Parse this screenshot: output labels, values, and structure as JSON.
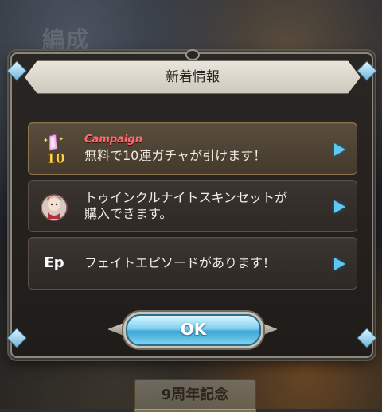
{
  "background": {
    "top_label": "編成",
    "bottom_banner": "9周年記念"
  },
  "dialog": {
    "title": "新着情報",
    "items": [
      {
        "tag": "Campaign",
        "icon_text": "10",
        "icon": "gacha-crystal-icon",
        "text": "無料で10連ガチャが引けます！"
      },
      {
        "icon": "character-skin-icon",
        "text_line1": "トゥインクルナイトスキンセットが",
        "text_line2": "購入できます。"
      },
      {
        "icon_text": "Ep",
        "icon": "episode-icon",
        "text": "フェイトエピソードがあります！"
      }
    ],
    "ok_label": "OK"
  },
  "colors": {
    "accent_blue": "#5fc8f0",
    "campaign_red": "#ff6a6a"
  }
}
